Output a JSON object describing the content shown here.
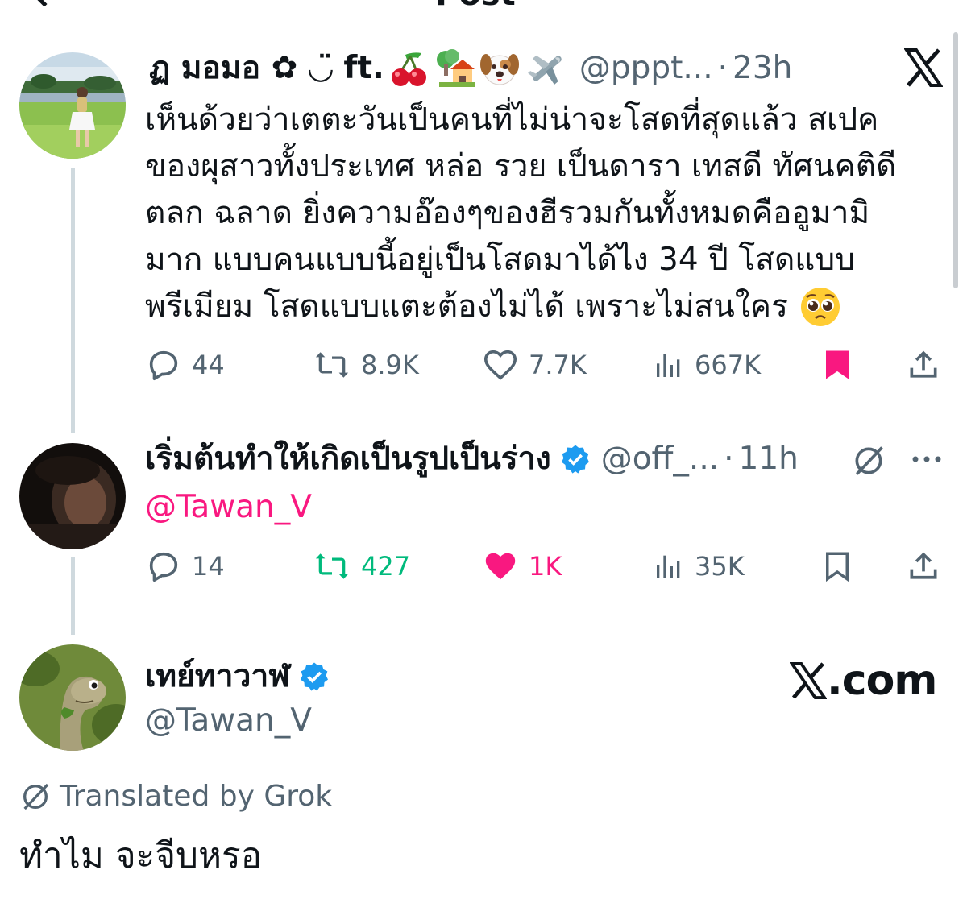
{
  "page": {
    "header_title": "Post"
  },
  "post1": {
    "name": "ฏ มอมอ ✿ ◡̈ ft.",
    "name_emojis": [
      "cherry-emoji",
      "house-tree-emoji",
      "dog-face-emoji",
      "airplane-emoji"
    ],
    "handle": "@pppt...",
    "dot": "·",
    "time": "23h",
    "text_lines": [
      "เห็นด้วยว่าเตตะวันเป็นคนที่ไม่น่าจะโสดที่สุดแล้ว สเปค",
      "ของผุสาวทั้งประเทศ หล่อ รวย เป็นดารา เทสดี ทัศนคติดี",
      "ตลก ฉลาด ยิ่งความอ๊องๆของฮีรวมกันทั้งหมดคืออูมามิ",
      "มาก แบบคนแบบนี้อยู่เป็นโสดมาได้ไง 34 ปี โสดแบบ",
      "พรีเมียม โสดแบบแตะต้องไม่ได้ เพราะไม่สนใคร"
    ],
    "end_emoji": "pleading-face-emoji",
    "stats": {
      "replies": "44",
      "reposts": "8.9K",
      "likes": "7.7K",
      "views": "667K"
    },
    "bookmarked": true,
    "colors": {
      "bookmark": "#f91880"
    }
  },
  "post2": {
    "name": "เริ่มต้นทำให้เกิดเป็นรูปเป็นร่าง",
    "verified": true,
    "handle": "@off_...",
    "dot": "·",
    "time": "11h",
    "mention": "@Tawan_V",
    "stats": {
      "replies": "14",
      "reposts": "427",
      "likes": "1K",
      "views": "35K"
    },
    "reposted": true,
    "liked": true,
    "colors": {
      "repost": "#00ba7c",
      "like": "#f91880",
      "mention": "#f91880"
    }
  },
  "post3": {
    "name": "เทย์ทาวาฬ",
    "verified": true,
    "handle": "@Tawan_V",
    "translated_label": "Translated by Grok",
    "text": "ทำไม จะจีบหรอ"
  },
  "watermark": {
    "text": ".com"
  },
  "colors": {
    "verified": "#1d9bf0",
    "muted": "#536471",
    "text": "#0f1419"
  }
}
